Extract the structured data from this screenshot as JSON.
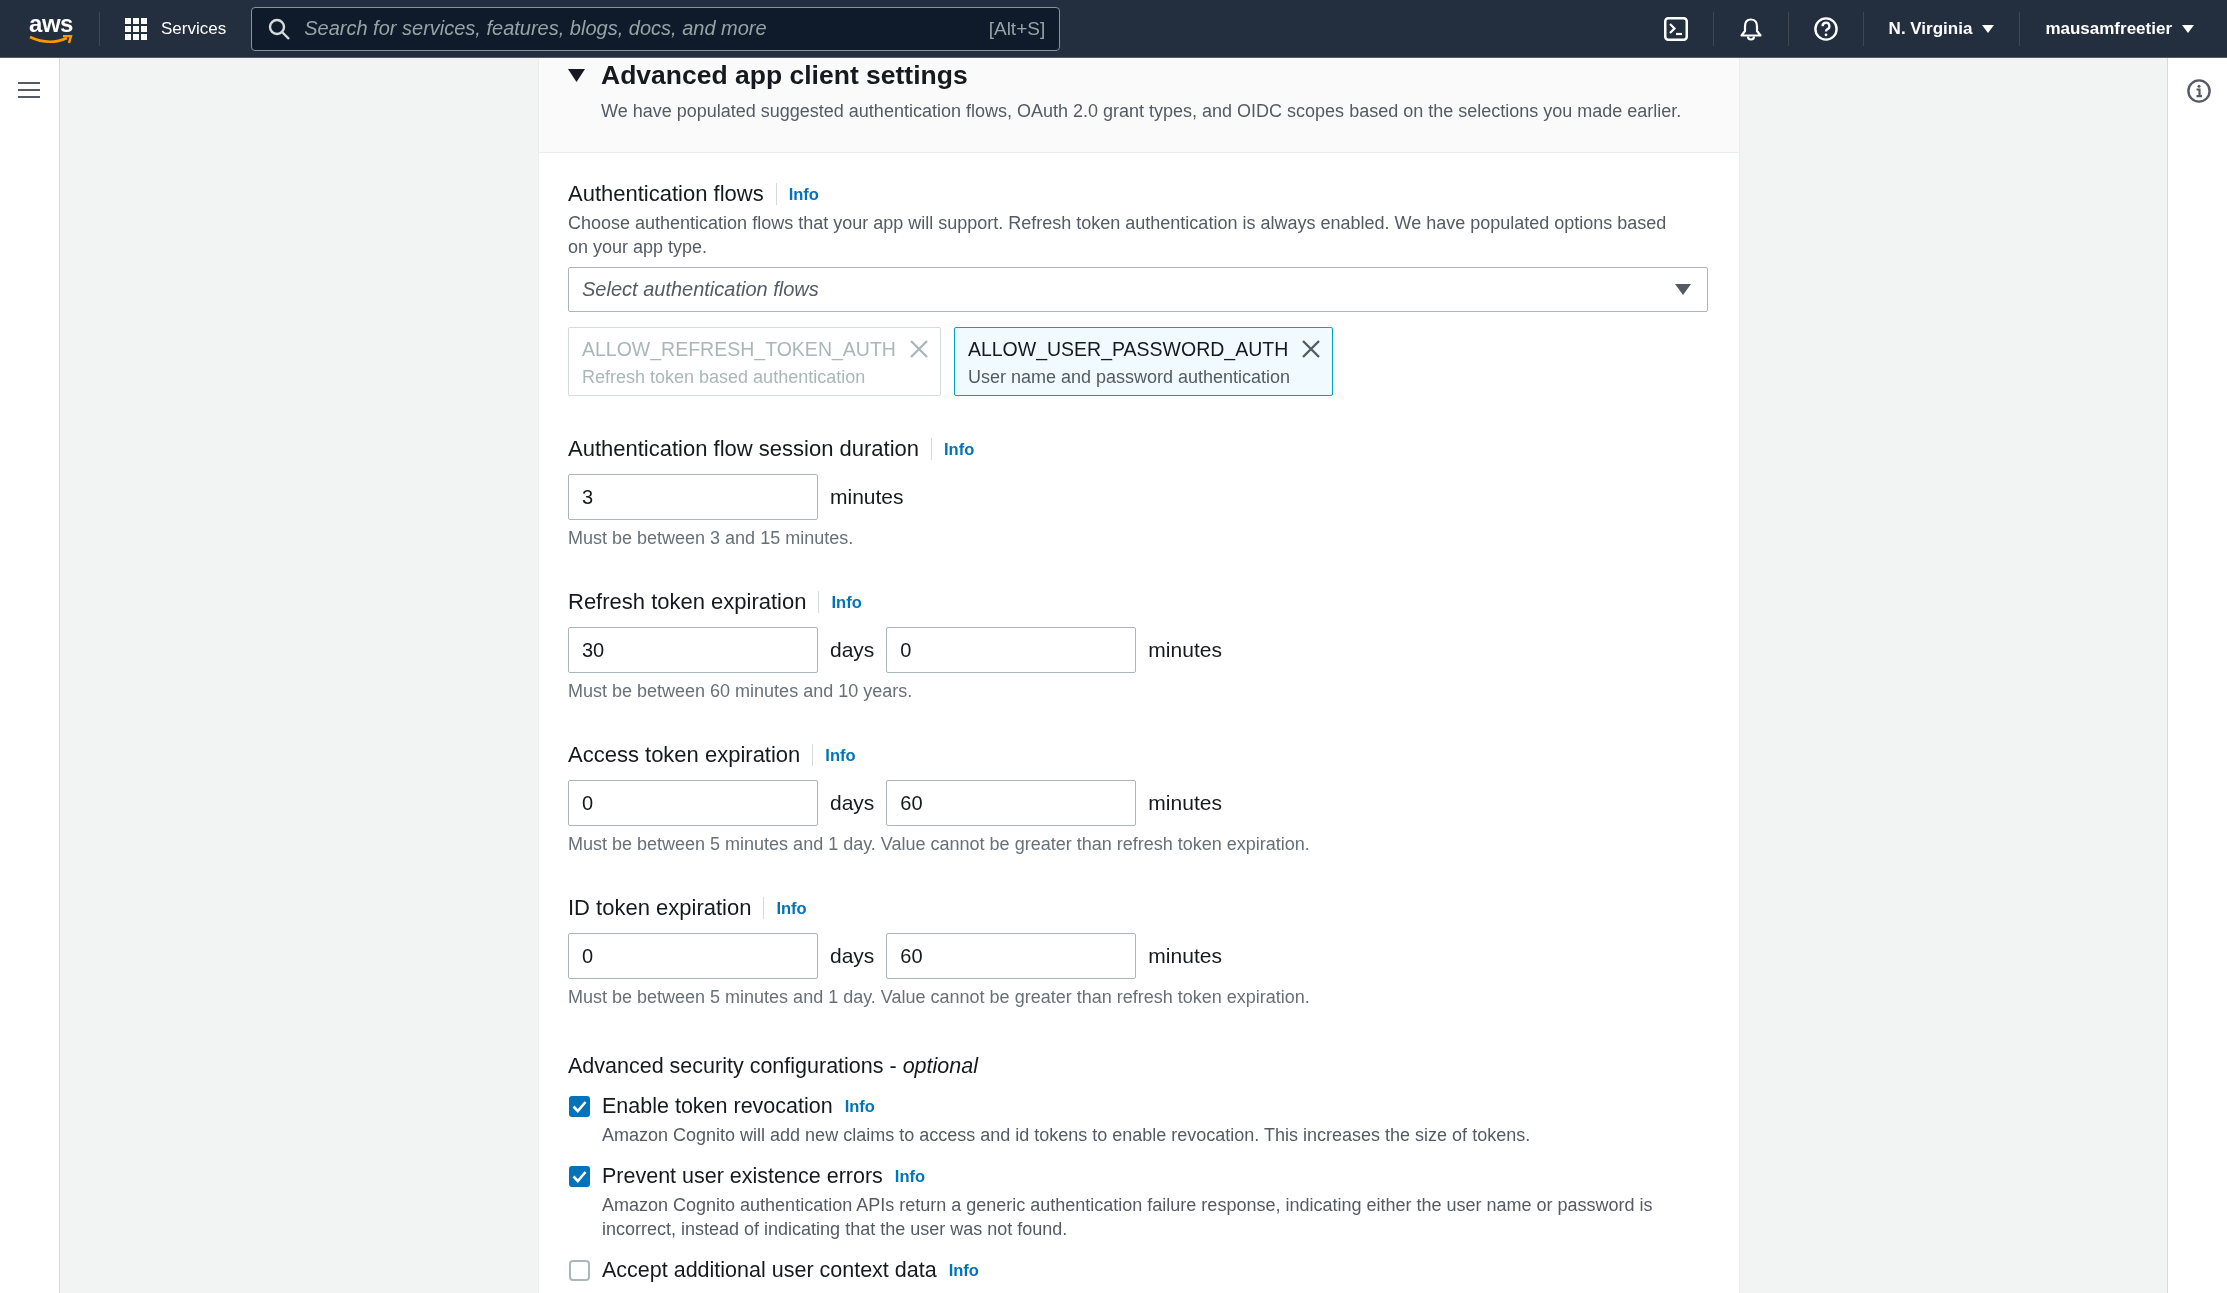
{
  "top_nav": {
    "logo_text": "aws",
    "services": "Services",
    "search": {
      "placeholder": "Search for services, features, blogs, docs, and more",
      "shortcut": "[Alt+S]"
    },
    "region": "N. Virginia",
    "account": "mausamfreetier"
  },
  "section": {
    "title": "Advanced app client settings",
    "expanded": true,
    "description": "We have populated suggested authentication flows, OAuth 2.0 grant types, and OIDC scopes based on the selections you made earlier."
  },
  "auth_flows": {
    "label": "Authentication flows",
    "info": "Info",
    "description": "Choose authentication flows that your app will support. Refresh token authentication is always enabled. We have populated options based on your app type.",
    "select": {
      "placeholder": "Select authentication flows"
    },
    "tokens": [
      {
        "name": "ALLOW_REFRESH_TOKEN_AUTH",
        "description": "Refresh token based authentication",
        "disabled": true
      },
      {
        "name": "ALLOW_USER_PASSWORD_AUTH",
        "description": "User name and password authentication",
        "disabled": false
      }
    ]
  },
  "expirations": [
    {
      "label": "Authentication flow session duration",
      "info": "Info",
      "fields": [
        {
          "value": "3",
          "unit": "minutes"
        }
      ],
      "hint": "Must be between 3 and 15 minutes."
    },
    {
      "label": "Refresh token expiration",
      "info": "Info",
      "fields": [
        {
          "value": "30",
          "unit": "days"
        },
        {
          "value": "0",
          "unit": "minutes"
        }
      ],
      "hint": "Must be between 60 minutes and 10 years."
    },
    {
      "label": "Access token expiration",
      "info": "Info",
      "fields": [
        {
          "value": "0",
          "unit": "days"
        },
        {
          "value": "60",
          "unit": "minutes"
        }
      ],
      "hint": "Must be between 5 minutes and 1 day. Value cannot be greater than refresh token expiration."
    },
    {
      "label": "ID token expiration",
      "info": "Info",
      "fields": [
        {
          "value": "0",
          "unit": "days"
        },
        {
          "value": "60",
          "unit": "minutes"
        }
      ],
      "hint": "Must be between 5 minutes and 1 day. Value cannot be greater than refresh token expiration."
    }
  ],
  "security": {
    "heading": "Advanced security configurations - *optional*",
    "options": [
      {
        "label": "Enable token revocation",
        "info": "Info",
        "description": "Amazon Cognito will add new claims to access and id tokens to enable revocation. This increases the size of tokens.",
        "checked": true
      },
      {
        "label": "Prevent user existence errors",
        "info": "Info",
        "description": "Amazon Cognito authentication APIs return a generic authentication failure response, indicating either the user name or password is incorrect, instead of indicating that the user was not found.",
        "checked": true
      },
      {
        "label": "Accept additional user context data",
        "info": "Info",
        "checked": false
      }
    ]
  }
}
